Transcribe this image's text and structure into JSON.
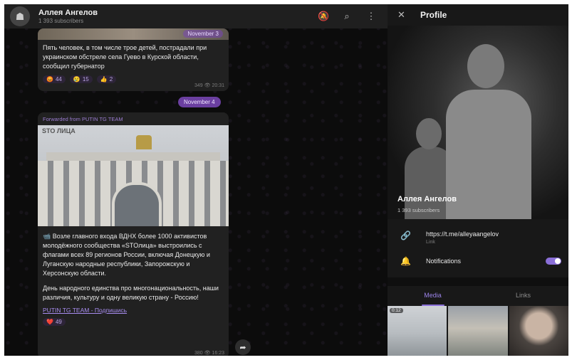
{
  "chat": {
    "title": "Аллея Ангелов",
    "subscribers": "1 393 subscribers",
    "icons": [
      "mute-bell-icon",
      "search-icon",
      "more-vertical-icon"
    ]
  },
  "messages": [
    {
      "date_tag": "November 3",
      "text": "Пять человек, в том числе трое детей, пострадали при украинском обстреле села Гуево в Курской области, сообщил губернатор",
      "reactions": [
        {
          "emoji": "😡",
          "count": "44"
        },
        {
          "emoji": "😢",
          "count": "15"
        },
        {
          "emoji": "👍",
          "count": "2"
        }
      ],
      "views": "349",
      "time": "20:31"
    },
    {
      "forwarded": "Forwarded from PUTIN TG TEAM",
      "photo_logo": "STO ЛИЦА",
      "text": "📹 Возле главного входа ВДНХ более 1000 активистов молодёжного сообщества «STOлица» выстроились с флагами всех 89 регионов России, включая Донецкую и Луганскую народные республики, Запорожскую и Херсонскую области.",
      "text2": "День народного единства про многонациональность, наши различия, культуру и одну великую страну - Россию!",
      "link": "PUTIN TG TEAM - Подпишись",
      "reactions": [
        {
          "emoji": "❤️",
          "count": "49"
        }
      ],
      "views": "380",
      "time": "16:23"
    }
  ],
  "date_pill": "November 4",
  "share_icon": "share-arrow-icon",
  "profile": {
    "header_title": "Profile",
    "name": "Аллея Ангелов",
    "subscribers": "1 393 subscribers",
    "link": "https://t.me/alleyaangelov",
    "link_caption": "Link",
    "notifications_label": "Notifications",
    "notifications_on": true,
    "tabs": [
      "Media",
      "Links"
    ],
    "active_tab": "Media",
    "media_duration": "0:12"
  },
  "colors": {
    "accent": "#8a6fd8",
    "date_pill": "#6b3fa0"
  }
}
